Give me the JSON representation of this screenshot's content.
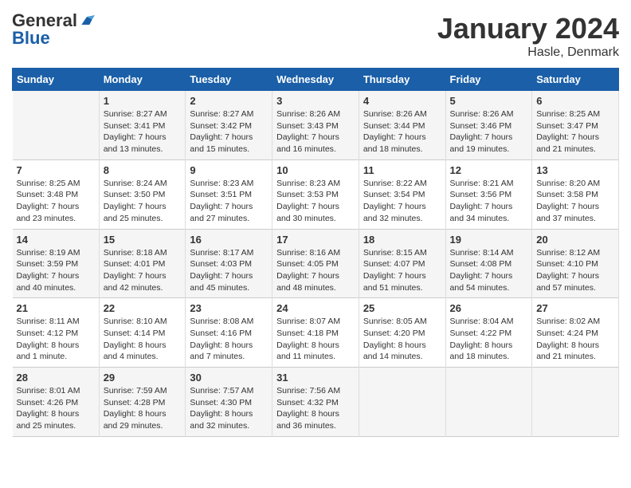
{
  "header": {
    "logo_general": "General",
    "logo_blue": "Blue",
    "month_title": "January 2024",
    "location": "Hasle, Denmark"
  },
  "days_of_week": [
    "Sunday",
    "Monday",
    "Tuesday",
    "Wednesday",
    "Thursday",
    "Friday",
    "Saturday"
  ],
  "weeks": [
    [
      {
        "day": "",
        "info": ""
      },
      {
        "day": "1",
        "info": "Sunrise: 8:27 AM\nSunset: 3:41 PM\nDaylight: 7 hours\nand 13 minutes."
      },
      {
        "day": "2",
        "info": "Sunrise: 8:27 AM\nSunset: 3:42 PM\nDaylight: 7 hours\nand 15 minutes."
      },
      {
        "day": "3",
        "info": "Sunrise: 8:26 AM\nSunset: 3:43 PM\nDaylight: 7 hours\nand 16 minutes."
      },
      {
        "day": "4",
        "info": "Sunrise: 8:26 AM\nSunset: 3:44 PM\nDaylight: 7 hours\nand 18 minutes."
      },
      {
        "day": "5",
        "info": "Sunrise: 8:26 AM\nSunset: 3:46 PM\nDaylight: 7 hours\nand 19 minutes."
      },
      {
        "day": "6",
        "info": "Sunrise: 8:25 AM\nSunset: 3:47 PM\nDaylight: 7 hours\nand 21 minutes."
      }
    ],
    [
      {
        "day": "7",
        "info": "Sunrise: 8:25 AM\nSunset: 3:48 PM\nDaylight: 7 hours\nand 23 minutes."
      },
      {
        "day": "8",
        "info": "Sunrise: 8:24 AM\nSunset: 3:50 PM\nDaylight: 7 hours\nand 25 minutes."
      },
      {
        "day": "9",
        "info": "Sunrise: 8:23 AM\nSunset: 3:51 PM\nDaylight: 7 hours\nand 27 minutes."
      },
      {
        "day": "10",
        "info": "Sunrise: 8:23 AM\nSunset: 3:53 PM\nDaylight: 7 hours\nand 30 minutes."
      },
      {
        "day": "11",
        "info": "Sunrise: 8:22 AM\nSunset: 3:54 PM\nDaylight: 7 hours\nand 32 minutes."
      },
      {
        "day": "12",
        "info": "Sunrise: 8:21 AM\nSunset: 3:56 PM\nDaylight: 7 hours\nand 34 minutes."
      },
      {
        "day": "13",
        "info": "Sunrise: 8:20 AM\nSunset: 3:58 PM\nDaylight: 7 hours\nand 37 minutes."
      }
    ],
    [
      {
        "day": "14",
        "info": "Sunrise: 8:19 AM\nSunset: 3:59 PM\nDaylight: 7 hours\nand 40 minutes."
      },
      {
        "day": "15",
        "info": "Sunrise: 8:18 AM\nSunset: 4:01 PM\nDaylight: 7 hours\nand 42 minutes."
      },
      {
        "day": "16",
        "info": "Sunrise: 8:17 AM\nSunset: 4:03 PM\nDaylight: 7 hours\nand 45 minutes."
      },
      {
        "day": "17",
        "info": "Sunrise: 8:16 AM\nSunset: 4:05 PM\nDaylight: 7 hours\nand 48 minutes."
      },
      {
        "day": "18",
        "info": "Sunrise: 8:15 AM\nSunset: 4:07 PM\nDaylight: 7 hours\nand 51 minutes."
      },
      {
        "day": "19",
        "info": "Sunrise: 8:14 AM\nSunset: 4:08 PM\nDaylight: 7 hours\nand 54 minutes."
      },
      {
        "day": "20",
        "info": "Sunrise: 8:12 AM\nSunset: 4:10 PM\nDaylight: 7 hours\nand 57 minutes."
      }
    ],
    [
      {
        "day": "21",
        "info": "Sunrise: 8:11 AM\nSunset: 4:12 PM\nDaylight: 8 hours\nand 1 minute."
      },
      {
        "day": "22",
        "info": "Sunrise: 8:10 AM\nSunset: 4:14 PM\nDaylight: 8 hours\nand 4 minutes."
      },
      {
        "day": "23",
        "info": "Sunrise: 8:08 AM\nSunset: 4:16 PM\nDaylight: 8 hours\nand 7 minutes."
      },
      {
        "day": "24",
        "info": "Sunrise: 8:07 AM\nSunset: 4:18 PM\nDaylight: 8 hours\nand 11 minutes."
      },
      {
        "day": "25",
        "info": "Sunrise: 8:05 AM\nSunset: 4:20 PM\nDaylight: 8 hours\nand 14 minutes."
      },
      {
        "day": "26",
        "info": "Sunrise: 8:04 AM\nSunset: 4:22 PM\nDaylight: 8 hours\nand 18 minutes."
      },
      {
        "day": "27",
        "info": "Sunrise: 8:02 AM\nSunset: 4:24 PM\nDaylight: 8 hours\nand 21 minutes."
      }
    ],
    [
      {
        "day": "28",
        "info": "Sunrise: 8:01 AM\nSunset: 4:26 PM\nDaylight: 8 hours\nand 25 minutes."
      },
      {
        "day": "29",
        "info": "Sunrise: 7:59 AM\nSunset: 4:28 PM\nDaylight: 8 hours\nand 29 minutes."
      },
      {
        "day": "30",
        "info": "Sunrise: 7:57 AM\nSunset: 4:30 PM\nDaylight: 8 hours\nand 32 minutes."
      },
      {
        "day": "31",
        "info": "Sunrise: 7:56 AM\nSunset: 4:32 PM\nDaylight: 8 hours\nand 36 minutes."
      },
      {
        "day": "",
        "info": ""
      },
      {
        "day": "",
        "info": ""
      },
      {
        "day": "",
        "info": ""
      }
    ]
  ]
}
